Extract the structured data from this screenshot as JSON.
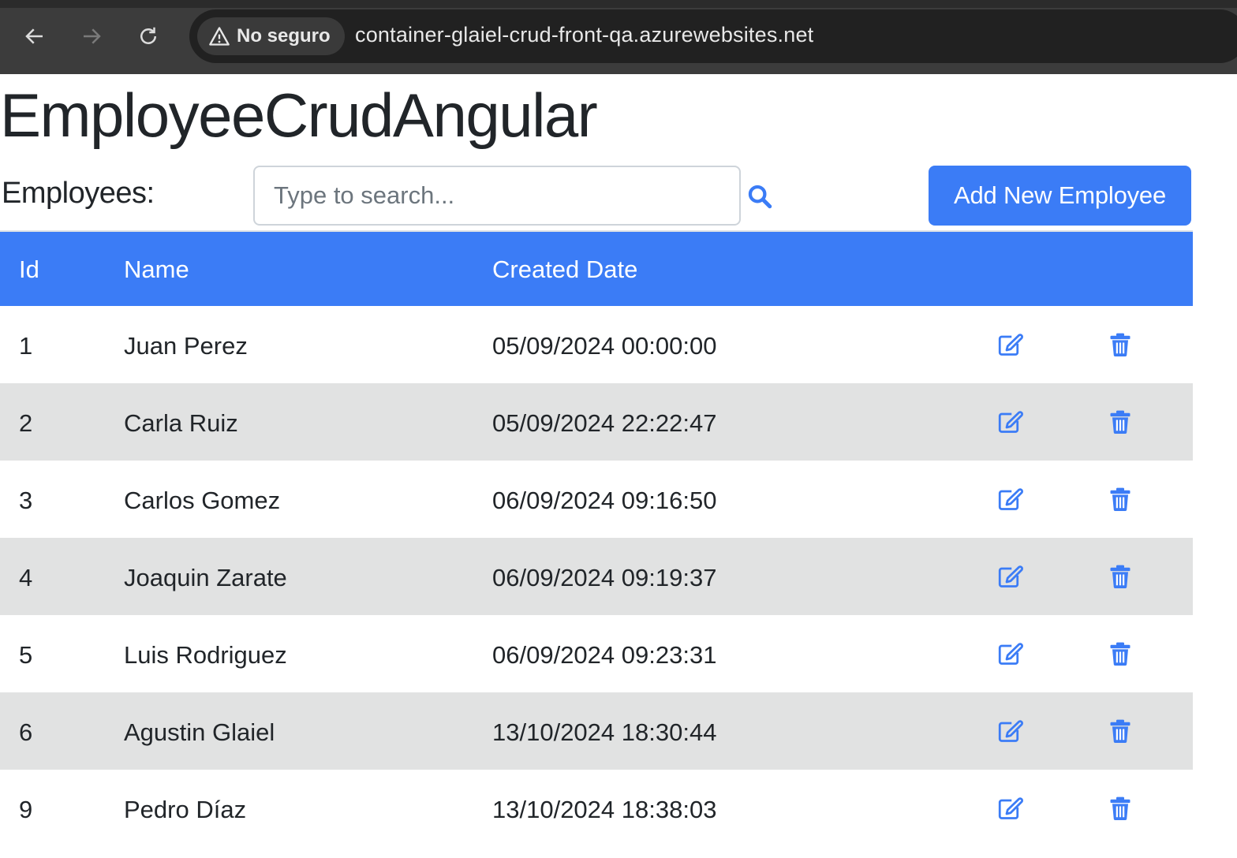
{
  "browser": {
    "security_label": "No seguro",
    "url": "container-glaiel-crud-front-qa.azurewebsites.net"
  },
  "app": {
    "title": "EmployeeCrudAngular"
  },
  "toolbar": {
    "employees_label": "Employees:",
    "search_placeholder": "Type to search...",
    "search_value": "",
    "add_button_label": "Add New Employee"
  },
  "table": {
    "headers": {
      "id": "Id",
      "name": "Name",
      "created": "Created Date"
    },
    "rows": [
      {
        "id": "1",
        "name": "Juan Perez",
        "created": "05/09/2024 00:00:00"
      },
      {
        "id": "2",
        "name": "Carla Ruiz",
        "created": "05/09/2024 22:22:47"
      },
      {
        "id": "3",
        "name": "Carlos Gomez",
        "created": "06/09/2024 09:16:50"
      },
      {
        "id": "4",
        "name": "Joaquin Zarate",
        "created": "06/09/2024 09:19:37"
      },
      {
        "id": "5",
        "name": "Luis Rodriguez",
        "created": "06/09/2024 09:23:31"
      },
      {
        "id": "6",
        "name": "Agustin Glaiel",
        "created": "13/10/2024 18:30:44"
      },
      {
        "id": "9",
        "name": "Pedro Díaz",
        "created": "13/10/2024 18:38:03"
      }
    ],
    "row_icons": {
      "edit": "edit-icon",
      "delete": "trash-icon"
    }
  },
  "colors": {
    "primary": "#3b7cf6",
    "stripe": "#e1e2e2",
    "text": "#212529"
  }
}
